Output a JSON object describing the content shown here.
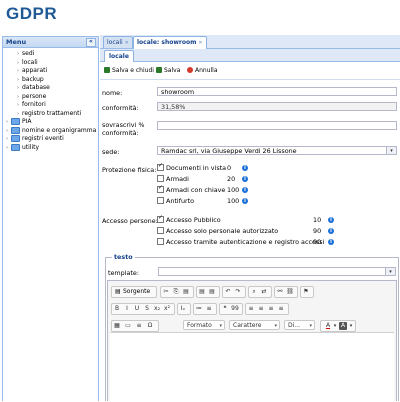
{
  "app": {
    "title": "GDPR"
  },
  "menu": {
    "header": "Menu",
    "collapse_glyph": "«",
    "items": [
      {
        "label": "sedi",
        "level": 1
      },
      {
        "label": "locali",
        "level": 1
      },
      {
        "label": "apparati",
        "level": 1
      },
      {
        "label": "backup",
        "level": 1
      },
      {
        "label": "database",
        "level": 1
      },
      {
        "label": "persone",
        "level": 1
      },
      {
        "label": "fornitori",
        "level": 1
      },
      {
        "label": "registro trattamenti",
        "level": 1
      },
      {
        "label": "PIA",
        "level": 0
      },
      {
        "label": "nomine e organigramma",
        "level": 0
      },
      {
        "label": "registri eventi",
        "level": 0
      },
      {
        "label": "utility",
        "level": 0
      }
    ]
  },
  "tabs": [
    {
      "label": "locali",
      "active": false
    },
    {
      "label": "locale: showroom",
      "active": true
    }
  ],
  "subtab": {
    "label": "locale"
  },
  "toolbar": {
    "save_close": "Salva e chiudi",
    "save": "Salva",
    "cancel": "Annulla"
  },
  "form": {
    "nome_label": "nome:",
    "nome_value": "showroom",
    "conformita_label": "conformità:",
    "conformita_value": "31,58%",
    "sovrascrivi_label_1": "sovrascrivi %",
    "sovrascrivi_label_2": "conformità:",
    "sovrascrivi_value": "",
    "sede_label": "sede:",
    "sede_value": "Ramdac srl, via Giuseppe Verdi 26 Lissone",
    "protezione_label": "Protezione fisica:",
    "protezione": [
      {
        "label": "Documenti in vista",
        "checked": true,
        "value": "0"
      },
      {
        "label": "Armadi",
        "checked": false,
        "value": "20"
      },
      {
        "label": "Armadi con chiave",
        "checked": true,
        "value": "100"
      },
      {
        "label": "Antifurto",
        "checked": false,
        "value": "100"
      }
    ],
    "accesso_label": "Accesso persone:",
    "accesso": [
      {
        "label": "Accesso Pubblico",
        "checked": true,
        "value": "10"
      },
      {
        "label": "Accesso solo personale autorizzato",
        "checked": false,
        "value": "90"
      },
      {
        "label": "Accesso tramite autenticazione e registro accessi",
        "checked": false,
        "value": "90"
      }
    ],
    "info_glyph": "i"
  },
  "testo": {
    "legend": "testo",
    "template_label": "template:",
    "template_value": ""
  },
  "editor": {
    "source_label": "Sorgente",
    "formato_label": "Formato",
    "carattere_label": "Carattere",
    "dim_label": "Di...",
    "row1_icons": [
      "✂",
      "⎘",
      "▤",
      "▤",
      "▤",
      "↶",
      "↷",
      "⌕",
      "⇄",
      "⚯",
      "⛓",
      "⚑"
    ],
    "row2_icons": [
      "B",
      "I",
      "U",
      "S",
      "x₂",
      "x²",
      "Iₓ",
      "≔",
      "≡",
      "❝",
      "99",
      "≡",
      "≡",
      "≡",
      "≡"
    ],
    "row3_icons": [
      "▦",
      "▭",
      "≡",
      "Ω"
    ],
    "color_label": "A",
    "bgcolor_label": "A"
  },
  "colors": {
    "brand": "#1f5a96",
    "accent": "#15428b",
    "info": "#1a6fd6"
  }
}
